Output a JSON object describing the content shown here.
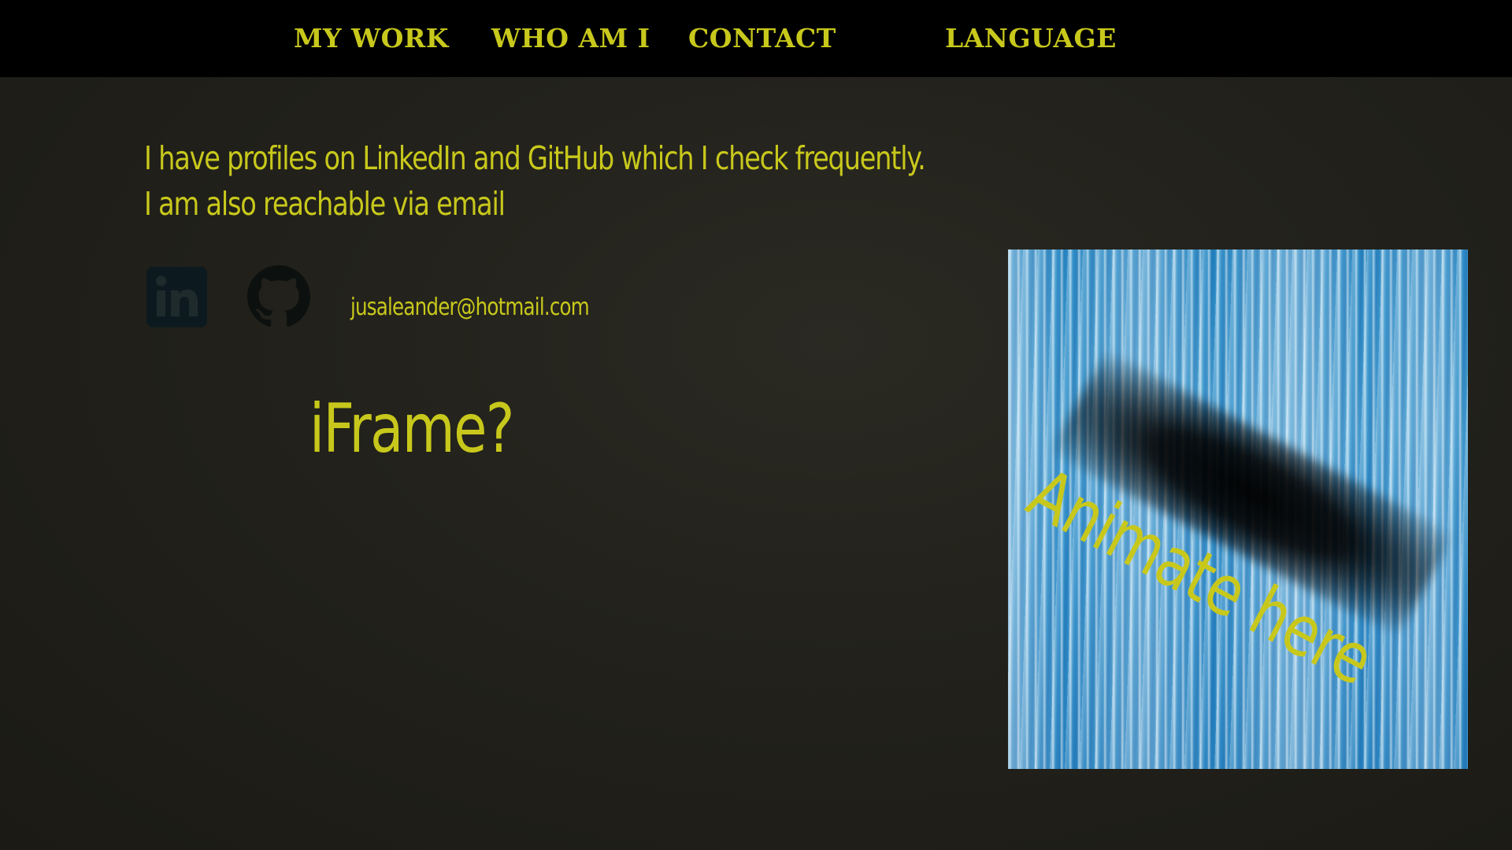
{
  "colors": {
    "accent": "#c8c81c",
    "nav_bg": "#000000",
    "page_bg": "#22211b",
    "icon_dark": "#0c1a1f"
  },
  "nav": {
    "items": [
      {
        "label": "MY WORK"
      },
      {
        "label": "WHO AM I"
      },
      {
        "label": "CONTACT"
      },
      {
        "label": "LANGUAGE"
      }
    ]
  },
  "contact": {
    "intro_line_1": "I have profiles on LinkedIn and GitHub which I check frequently.",
    "intro_line_2": "I am also reachable via email",
    "email": "jusaleander@hotmail.com",
    "icons": [
      "linkedin-icon",
      "github-icon"
    ]
  },
  "main": {
    "iframe_placeholder": "iFrame?"
  },
  "animation_panel": {
    "text": "Animate here"
  }
}
